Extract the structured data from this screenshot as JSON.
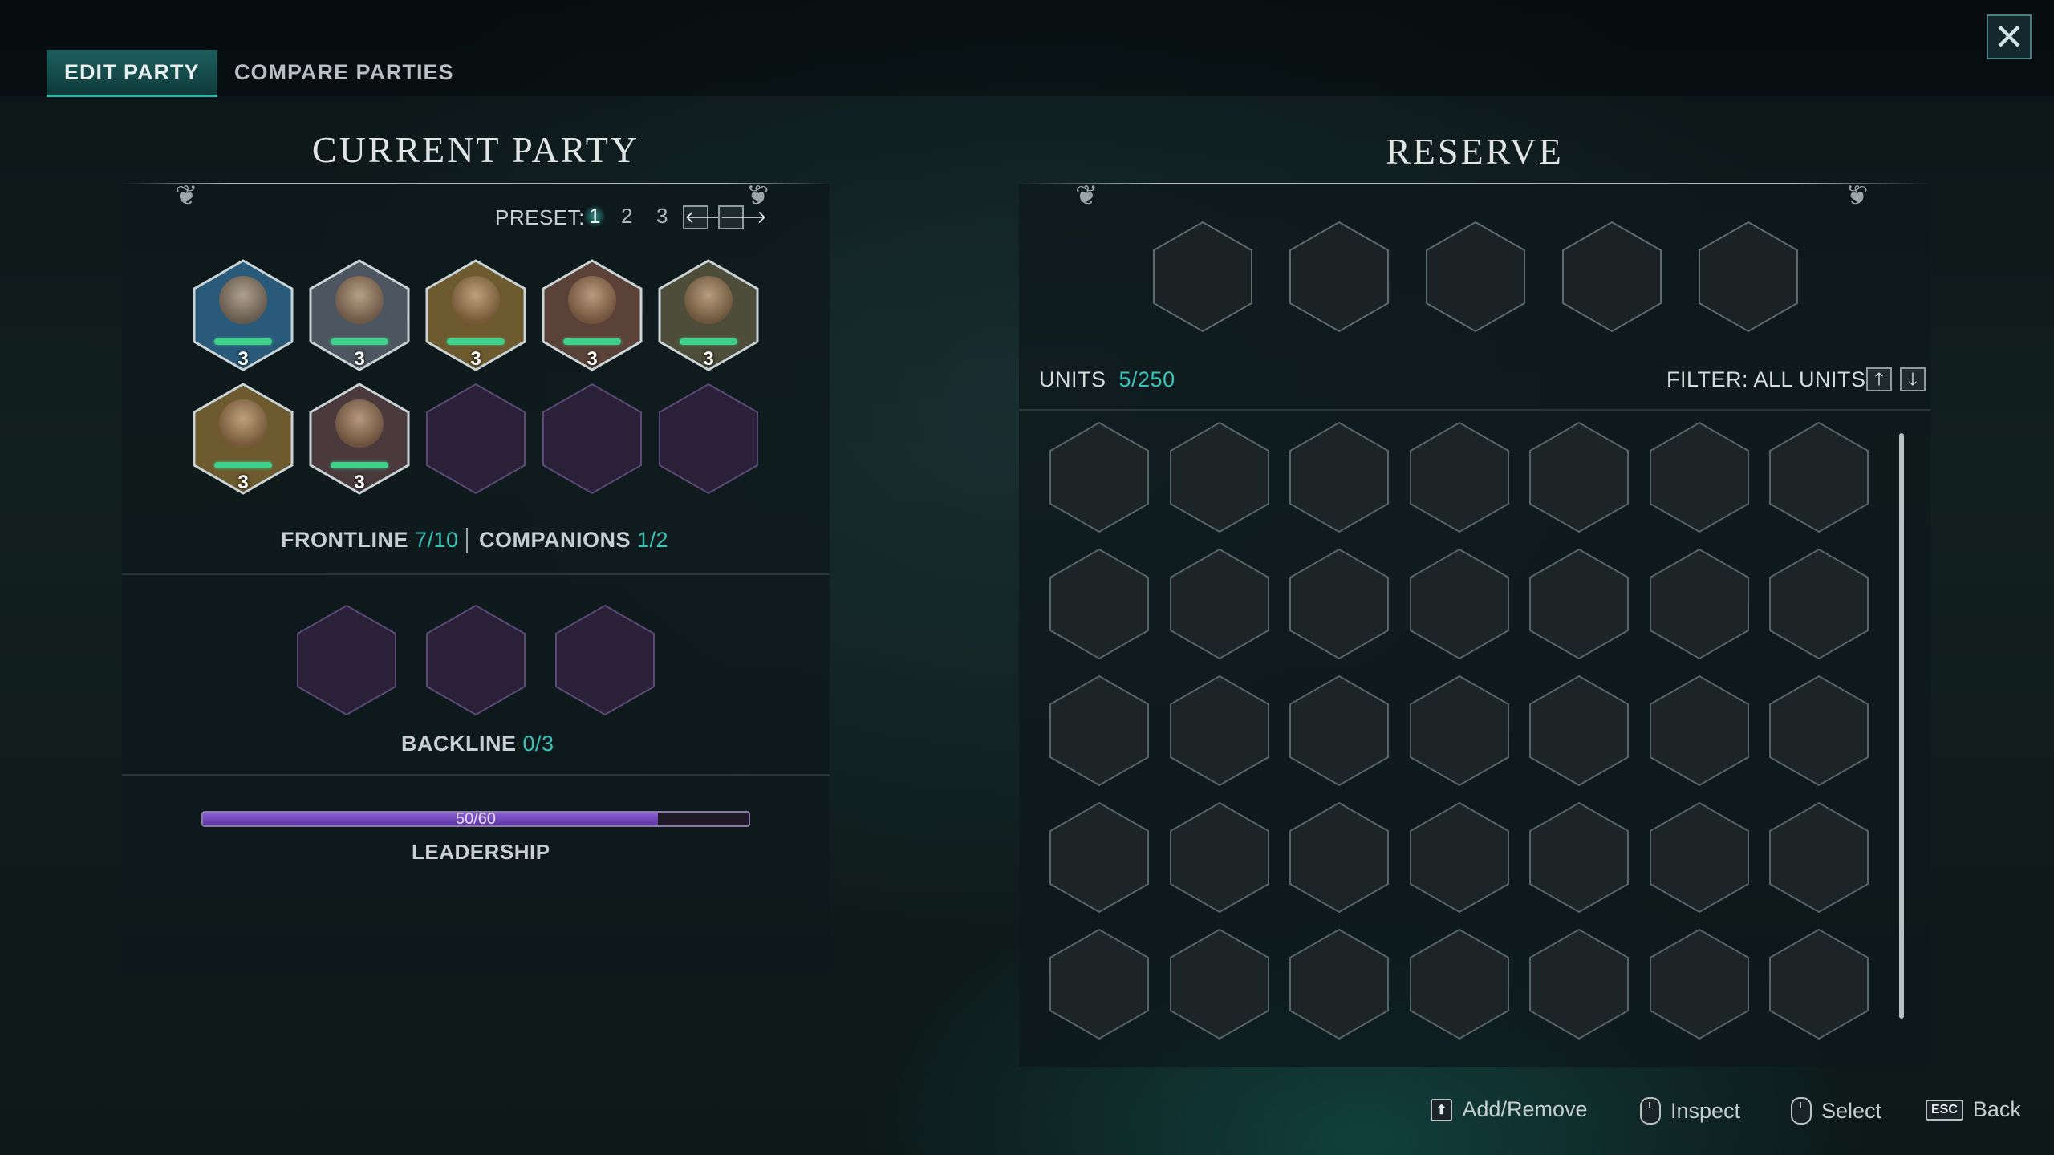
{
  "tabs": [
    {
      "label": "EDIT PARTY",
      "active": true
    },
    {
      "label": "COMPARE PARTIES",
      "active": false
    }
  ],
  "close_icon": "close-x-icon",
  "current_party": {
    "title": "CURRENT PARTY",
    "preset_label": "PRESET:",
    "presets": [
      "1",
      "2",
      "3"
    ],
    "active_preset": "1",
    "frontline": [
      {
        "portrait": "sorceress-portrait",
        "level": "3",
        "tint": "#2a5a7a"
      },
      {
        "portrait": "dwarf-veteran-portrait",
        "level": "3",
        "tint": "#4d5660"
      },
      {
        "portrait": "dwarf-blonde-portrait",
        "level": "3",
        "tint": "#6d5a2e"
      },
      {
        "portrait": "horned-creature-portrait",
        "level": "3",
        "tint": "#5a4238"
      },
      {
        "portrait": "armored-knight-portrait",
        "level": "3",
        "tint": "#4d4d3a"
      },
      {
        "portrait": "dwarf-blonde-portrait",
        "level": "3",
        "tint": "#6d5a2e"
      },
      {
        "portrait": "dark-elf-warrior-portrait",
        "level": "3",
        "tint": "#4a3a3e"
      },
      null,
      null,
      null
    ],
    "frontline_label": "FRONTLINE",
    "frontline_count": "7/10",
    "companions_label": "COMPANIONS",
    "companions_count": "1/2",
    "backline_label": "BACKLINE",
    "backline_count": "0/3",
    "leadership_label": "LEADERSHIP",
    "leadership_text": "50/60",
    "leadership_value": 50,
    "leadership_max": 60
  },
  "reserve": {
    "title": "RESERVE",
    "companion_slots": 5,
    "units_label": "UNITS",
    "units_count": "5/250",
    "filter_label": "FILTER: ALL UNITS",
    "grid_rows": 5,
    "grid_cols": 7
  },
  "hints": [
    {
      "key": "⬆",
      "label": "Add/Remove",
      "icon": "shift-key-icon"
    },
    {
      "key": "",
      "label": "Inspect",
      "icon": "right-mouse-icon"
    },
    {
      "key": "",
      "label": "Select",
      "icon": "left-mouse-icon"
    },
    {
      "key": "ESC",
      "label": "Back",
      "icon": "esc-key-icon"
    }
  ],
  "colors": {
    "accent_teal": "#3ac3ba",
    "health_green": "#3fd08c",
    "leadership_purple": "#7a4cc2",
    "empty_slot_purple": "#2a2038"
  }
}
